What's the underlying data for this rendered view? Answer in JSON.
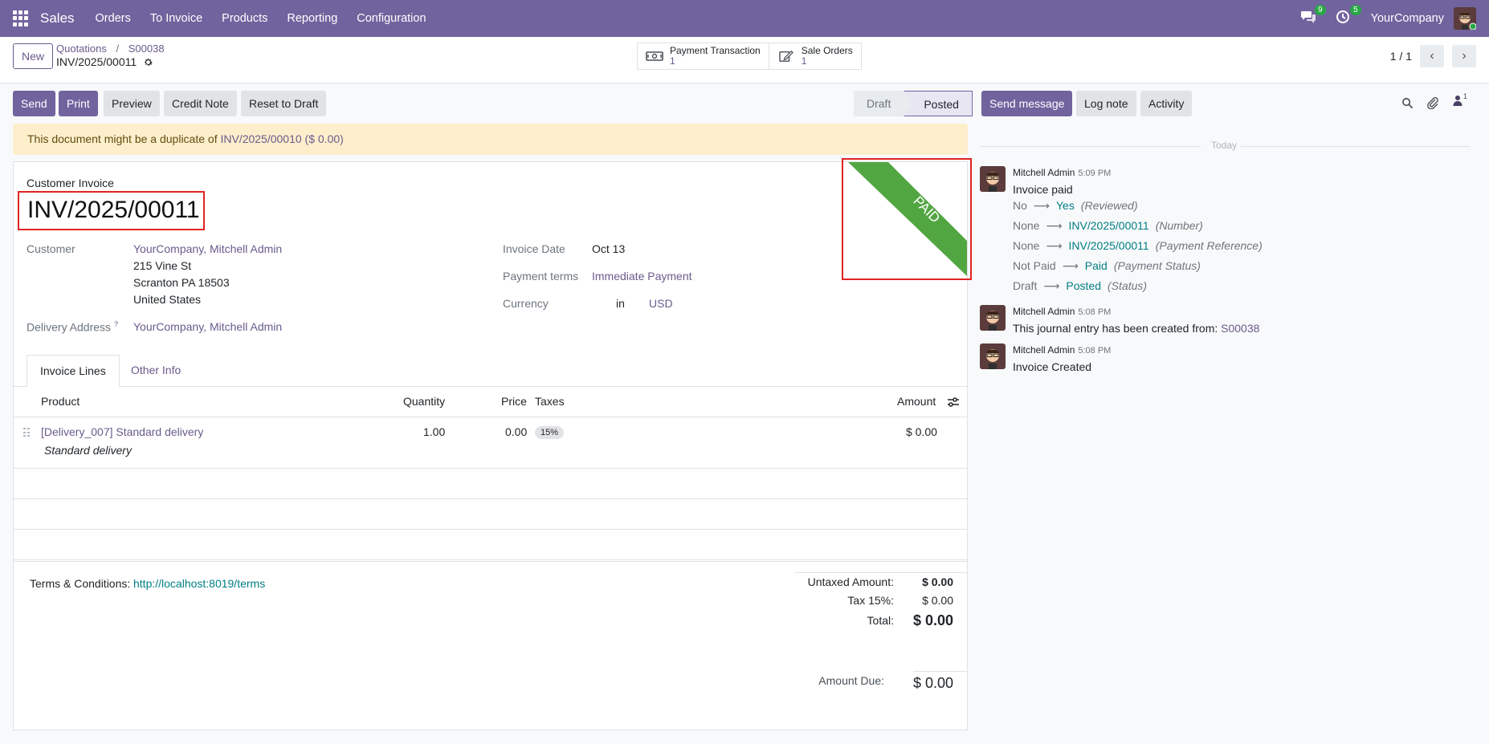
{
  "nav": {
    "app_name": "Sales",
    "menu": [
      "Orders",
      "To Invoice",
      "Products",
      "Reporting",
      "Configuration"
    ],
    "messages_count": "9",
    "activities_count": "5",
    "company": "YourCompany"
  },
  "control": {
    "new_label": "New",
    "breadcrumbs": [
      "Quotations",
      "S00038"
    ],
    "record_name": "INV/2025/00011",
    "smart_buttons": [
      {
        "label": "Payment Transaction",
        "count": "1",
        "icon": "money-icon"
      },
      {
        "label": "Sale Orders",
        "count": "1",
        "icon": "edit-icon"
      }
    ],
    "pager": "1 / 1"
  },
  "actions": {
    "send": "Send",
    "print": "Print",
    "preview": "Preview",
    "credit_note": "Credit Note",
    "reset_to_draft": "Reset to Draft"
  },
  "statusbar": {
    "draft": "Draft",
    "posted": "Posted"
  },
  "alert": {
    "text": "This document might be a duplicate of",
    "link": "INV/2025/00010 ($ 0.00)"
  },
  "invoice": {
    "doc_type": "Customer Invoice",
    "name": "INV/2025/00011",
    "ribbon": "PAID",
    "customer_label": "Customer",
    "customer_name": "YourCompany, Mitchell Admin",
    "address_line1": "215 Vine St",
    "address_line2": "Scranton PA 18503",
    "address_line3": "United States",
    "delivery_label": "Delivery Address",
    "delivery_help": "?",
    "delivery_value": "YourCompany, Mitchell Admin",
    "invoice_date_label": "Invoice Date",
    "invoice_date": "Oct 13",
    "payment_terms_label": "Payment terms",
    "payment_terms": "Immediate Payment",
    "currency_label": "Currency",
    "currency_in": "in",
    "currency": "USD"
  },
  "tabs": [
    "Invoice Lines",
    "Other Info"
  ],
  "lines": {
    "headers": {
      "product": "Product",
      "quantity": "Quantity",
      "price": "Price",
      "taxes": "Taxes",
      "amount": "Amount"
    },
    "rows": [
      {
        "product": "[Delivery_007] Standard delivery",
        "description": "Standard delivery",
        "quantity": "1.00",
        "price": "0.00",
        "tax": "15%",
        "amount": "$ 0.00"
      }
    ]
  },
  "footer": {
    "terms_label": "Terms & Conditions:",
    "terms_link": "http://localhost:8019/terms",
    "untaxed_label": "Untaxed Amount:",
    "untaxed": "$ 0.00",
    "tax_label": "Tax 15%:",
    "tax": "$ 0.00",
    "total_label": "Total:",
    "total": "$ 0.00",
    "amount_due_label": "Amount Due:",
    "amount_due": "$ 0.00"
  },
  "chatter": {
    "send_message": "Send message",
    "log_note": "Log note",
    "activity": "Activity",
    "followers_count": "1",
    "today": "Today",
    "messages": [
      {
        "author": "Mitchell Admin",
        "time": "5:09 PM",
        "body": "Invoice paid",
        "tracking": [
          {
            "old": "No",
            "new": "Yes",
            "field": "(Reviewed)"
          },
          {
            "old": "None",
            "new": "INV/2025/00011",
            "field": "(Number)"
          },
          {
            "old": "None",
            "new": "INV/2025/00011",
            "field": "(Payment Reference)"
          },
          {
            "old": "Not Paid",
            "new": "Paid",
            "field": "(Payment Status)"
          },
          {
            "old": "Draft",
            "new": "Posted",
            "field": "(Status)"
          }
        ]
      },
      {
        "author": "Mitchell Admin",
        "time": "5:08 PM",
        "body": "This journal entry has been created from:",
        "link": "S00038"
      },
      {
        "author": "Mitchell Admin",
        "time": "5:08 PM",
        "body": "Invoice Created"
      }
    ]
  },
  "colors": {
    "brand": "#71639e",
    "ribbon": "#52a642",
    "highlight_box": "#e02424",
    "link": "#6a5a8c",
    "teal": "#017e84"
  }
}
